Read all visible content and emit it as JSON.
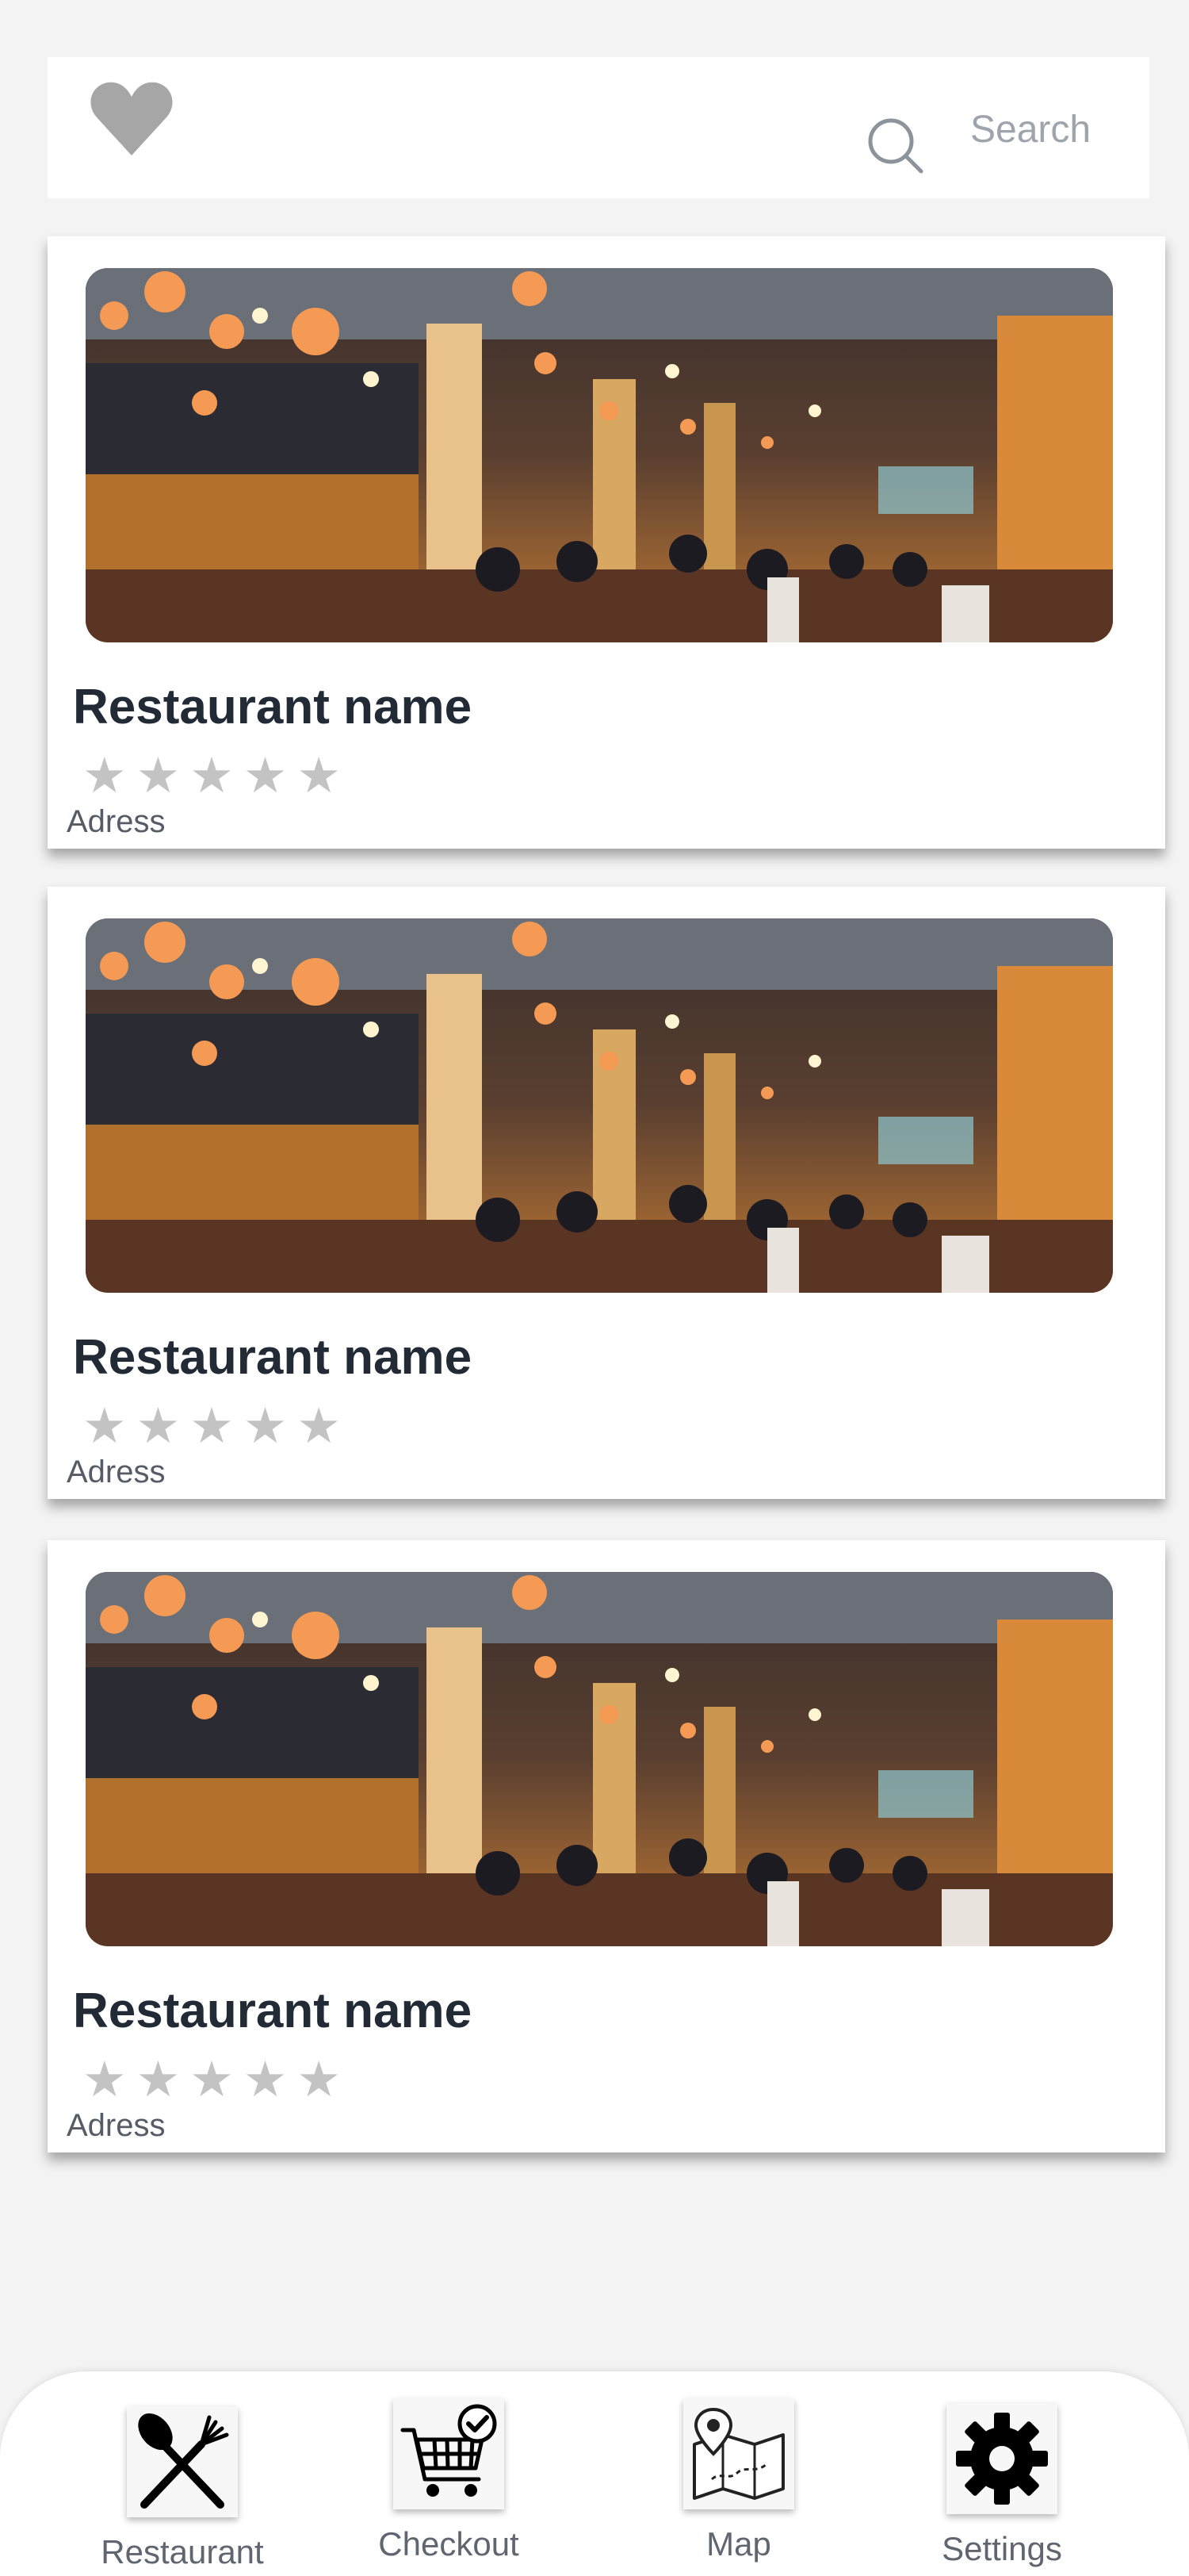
{
  "header": {
    "favorite_icon": "heart-icon",
    "search_icon": "search-icon",
    "search_placeholder": "Search"
  },
  "restaurants": [
    {
      "name": "Restaurant name",
      "rating": 0,
      "max_rating": 5,
      "address": "Adress"
    },
    {
      "name": "Restaurant name",
      "rating": 0,
      "max_rating": 5,
      "address": "Adress"
    },
    {
      "name": "Restaurant name",
      "rating": 0,
      "max_rating": 5,
      "address": "Adress"
    }
  ],
  "bottom_nav": {
    "items": [
      {
        "label": "Restaurant",
        "icon": "fork-knife-icon"
      },
      {
        "label": "Checkout",
        "icon": "cart-check-icon"
      },
      {
        "label": "Map",
        "icon": "map-pin-icon"
      },
      {
        "label": "Settings",
        "icon": "gear-icon"
      }
    ]
  },
  "colors": {
    "background": "#f3f3f3",
    "card": "#ffffff",
    "title": "#222a35",
    "star_empty": "#c3c3c3",
    "muted_text": "#9ea4ac",
    "icon_gray": "#a6a6a6"
  }
}
